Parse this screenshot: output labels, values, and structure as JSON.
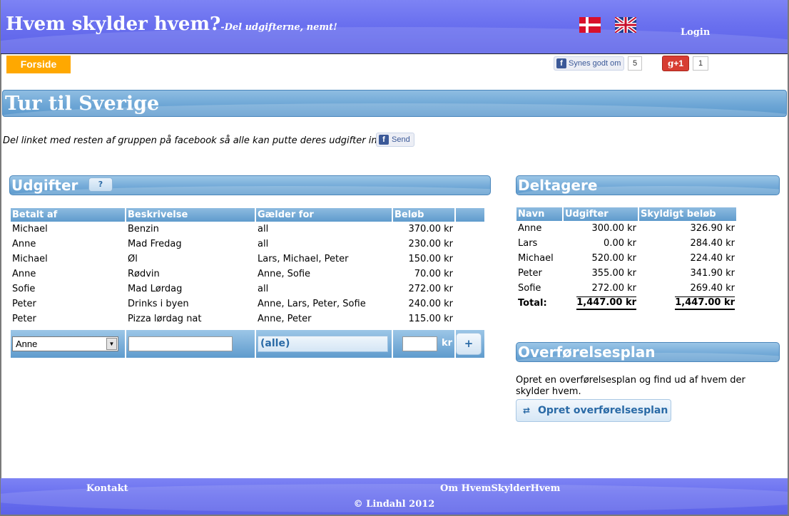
{
  "header": {
    "title": "Hvem skylder hvem?",
    "tagline": "-Del udgifterne, nemt!",
    "login": "Login",
    "flags": [
      "danish-flag",
      "uk-flag"
    ]
  },
  "nav": {
    "forside": "Forside",
    "facebook_like": "Synes godt om",
    "facebook_like_count": "5",
    "gplus": "+1",
    "gplus_count": "1"
  },
  "page": {
    "title": "Tur til Sverige",
    "share_text": "Del linket med resten af gruppen på facebook så alle kan putte deres udgifter ind.",
    "send_label": "Send"
  },
  "expenses": {
    "title": "Udgifter",
    "help": "?",
    "columns": [
      "Betalt af",
      "Beskrivelse",
      "Gælder for",
      "Beløb"
    ],
    "rows": [
      [
        "Michael",
        "Benzin",
        "all",
        "370.00 kr"
      ],
      [
        "Anne",
        "Mad Fredag",
        "all",
        "230.00 kr"
      ],
      [
        "Michael",
        "Øl",
        "Lars, Michael, Peter",
        "150.00 kr"
      ],
      [
        "Anne",
        "Rødvin",
        "Anne, Sofie",
        "70.00 kr"
      ],
      [
        "Sofie",
        "Mad Lørdag",
        "all",
        "272.00 kr"
      ],
      [
        "Peter",
        "Drinks i byen",
        "Anne, Lars, Peter, Sofie",
        "240.00 kr"
      ],
      [
        "Peter",
        "Pizza lørdag nat",
        "Anne, Peter",
        "115.00 kr"
      ]
    ],
    "new_row": {
      "payer_selected": "Anne",
      "description_value": "",
      "applies_to": "(alle)",
      "amount_value": "",
      "currency": "kr",
      "add": "+"
    }
  },
  "participants": {
    "title": "Deltagere",
    "columns": [
      "Navn",
      "Udgifter",
      "Skyldigt beløb"
    ],
    "rows": [
      [
        "Anne",
        "300.00 kr",
        "326.90 kr"
      ],
      [
        "Lars",
        "0.00 kr",
        "284.40 kr"
      ],
      [
        "Michael",
        "520.00 kr",
        "224.40 kr"
      ],
      [
        "Peter",
        "355.00 kr",
        "341.90 kr"
      ],
      [
        "Sofie",
        "272.00 kr",
        "269.40 kr"
      ]
    ],
    "total_label": "Total:",
    "total_expenses": "1,447.00 kr",
    "total_owed": "1,447.00 kr"
  },
  "transfer": {
    "title": "Overførelsesplan",
    "text": "Opret en overførelsesplan og find ud af hvem der skylder hvem.",
    "button": "Opret overførelsesplan"
  },
  "footer": {
    "contact": "Kontakt",
    "about": "Om HvemSkylderHvem",
    "copyright": "© Lindahl 2012"
  },
  "colors": {
    "header_blue": "#6a70ef",
    "banner_blue": "#6ea7d6",
    "forside_orange": "#ffa800",
    "link_blue": "#2a6aa6"
  }
}
